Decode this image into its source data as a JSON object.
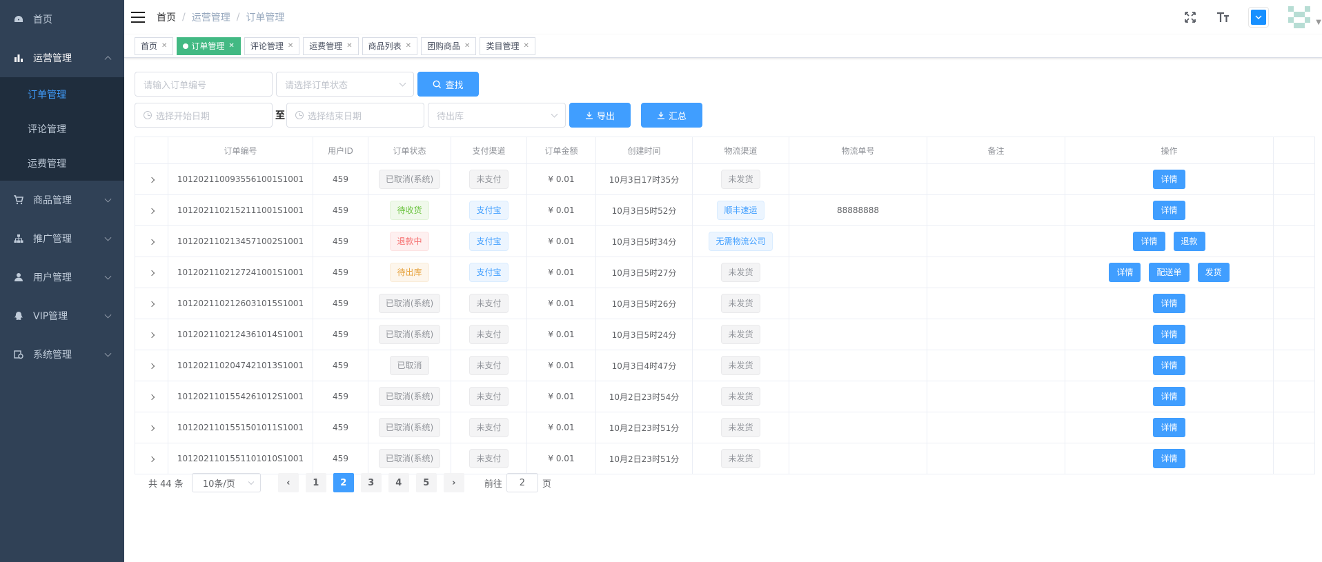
{
  "sidebar": {
    "items": [
      {
        "label": "首页",
        "icon": "dashboard-icon"
      },
      {
        "label": "运营管理",
        "icon": "chart-icon",
        "open": true,
        "children": [
          {
            "label": "订单管理",
            "active": true
          },
          {
            "label": "评论管理"
          },
          {
            "label": "运费管理"
          }
        ]
      },
      {
        "label": "商品管理",
        "icon": "cart-icon"
      },
      {
        "label": "推广管理",
        "icon": "tree-icon"
      },
      {
        "label": "用户管理",
        "icon": "user-icon"
      },
      {
        "label": "VIP管理",
        "icon": "qq-icon"
      },
      {
        "label": "系统管理",
        "icon": "system-icon"
      }
    ]
  },
  "breadcrumb": [
    "首页",
    "运营管理",
    "订单管理"
  ],
  "tags": [
    {
      "label": "首页"
    },
    {
      "label": "订单管理",
      "active": true
    },
    {
      "label": "评论管理"
    },
    {
      "label": "运费管理"
    },
    {
      "label": "商品列表"
    },
    {
      "label": "团购商品"
    },
    {
      "label": "类目管理"
    }
  ],
  "filters": {
    "order_no_placeholder": "请输入订单编号",
    "status_placeholder": "请选择订单状态",
    "search_label": "查找",
    "start_date_placeholder": "选择开始日期",
    "range_sep": "至",
    "end_date_placeholder": "选择结束日期",
    "stock_placeholder": "待出库",
    "export_label": "导出",
    "summary_label": "汇总"
  },
  "table": {
    "headers": [
      "订单编号",
      "用户ID",
      "订单状态",
      "支付渠道",
      "订单金额",
      "创建时间",
      "物流渠道",
      "物流单号",
      "备注",
      "操作"
    ],
    "rows": [
      {
        "order_no": "1012021100935561001S1001",
        "user_id": "459",
        "status": "已取消(系统)",
        "status_type": "info",
        "pay": "未支付",
        "pay_type": "info",
        "amount": "¥ 0.01",
        "created": "10月3日17时35分",
        "logistics": "未发货",
        "logistics_type": "info",
        "tracking": "",
        "remark": "",
        "actions": [
          "详情"
        ]
      },
      {
        "order_no": "1012021102152111001S1001",
        "user_id": "459",
        "status": "待收货",
        "status_type": "success",
        "pay": "支付宝",
        "pay_type": "primary",
        "amount": "¥ 0.01",
        "created": "10月3日5时52分",
        "logistics": "顺丰速运",
        "logistics_type": "primary",
        "tracking": "88888888",
        "remark": "",
        "actions": [
          "详情"
        ]
      },
      {
        "order_no": "1012021102134571002S1001",
        "user_id": "459",
        "status": "退款中",
        "status_type": "danger",
        "pay": "支付宝",
        "pay_type": "primary",
        "amount": "¥ 0.01",
        "created": "10月3日5时34分",
        "logistics": "无需物流公司",
        "logistics_type": "primary",
        "tracking": "",
        "remark": "",
        "actions": [
          "详情",
          "退款"
        ]
      },
      {
        "order_no": "1012021102127241001S1001",
        "user_id": "459",
        "status": "待出库",
        "status_type": "warning",
        "pay": "支付宝",
        "pay_type": "primary",
        "amount": "¥ 0.01",
        "created": "10月3日5时27分",
        "logistics": "未发货",
        "logistics_type": "info",
        "tracking": "",
        "remark": "",
        "actions": [
          "详情",
          "配送单",
          "发货"
        ]
      },
      {
        "order_no": "1012021102126031015S1001",
        "user_id": "459",
        "status": "已取消(系统)",
        "status_type": "info",
        "pay": "未支付",
        "pay_type": "info",
        "amount": "¥ 0.01",
        "created": "10月3日5时26分",
        "logistics": "未发货",
        "logistics_type": "info",
        "tracking": "",
        "remark": "",
        "actions": [
          "详情"
        ]
      },
      {
        "order_no": "1012021102124361014S1001",
        "user_id": "459",
        "status": "已取消(系统)",
        "status_type": "info",
        "pay": "未支付",
        "pay_type": "info",
        "amount": "¥ 0.01",
        "created": "10月3日5时24分",
        "logistics": "未发货",
        "logistics_type": "info",
        "tracking": "",
        "remark": "",
        "actions": [
          "详情"
        ]
      },
      {
        "order_no": "1012021102047421013S1001",
        "user_id": "459",
        "status": "已取消",
        "status_type": "info",
        "pay": "未支付",
        "pay_type": "info",
        "amount": "¥ 0.01",
        "created": "10月3日4时47分",
        "logistics": "未发货",
        "logistics_type": "info",
        "tracking": "",
        "remark": "",
        "actions": [
          "详情"
        ]
      },
      {
        "order_no": "1012021101554261012S1001",
        "user_id": "459",
        "status": "已取消(系统)",
        "status_type": "info",
        "pay": "未支付",
        "pay_type": "info",
        "amount": "¥ 0.01",
        "created": "10月2日23时54分",
        "logistics": "未发货",
        "logistics_type": "info",
        "tracking": "",
        "remark": "",
        "actions": [
          "详情"
        ]
      },
      {
        "order_no": "1012021101551501011S1001",
        "user_id": "459",
        "status": "已取消(系统)",
        "status_type": "info",
        "pay": "未支付",
        "pay_type": "info",
        "amount": "¥ 0.01",
        "created": "10月2日23时51分",
        "logistics": "未发货",
        "logistics_type": "info",
        "tracking": "",
        "remark": "",
        "actions": [
          "详情"
        ]
      },
      {
        "order_no": "1012021101551101010S1001",
        "user_id": "459",
        "status": "已取消(系统)",
        "status_type": "info",
        "pay": "未支付",
        "pay_type": "info",
        "amount": "¥ 0.01",
        "created": "10月2日23时51分",
        "logistics": "未发货",
        "logistics_type": "info",
        "tracking": "",
        "remark": "",
        "actions": [
          "详情"
        ]
      }
    ]
  },
  "pagination": {
    "total_text": "共 44 条",
    "page_size": "10条/页",
    "pages": [
      "1",
      "2",
      "3",
      "4",
      "5"
    ],
    "current": "2",
    "prev": "‹",
    "next": "›",
    "goto_label": "前往",
    "goto_value": "2",
    "page_suffix": "页"
  },
  "colors": {
    "sidebar_bg": "#304156",
    "submenu_bg": "#1f2d3d",
    "primary": "#409eff",
    "tag_active": "#42b983"
  }
}
